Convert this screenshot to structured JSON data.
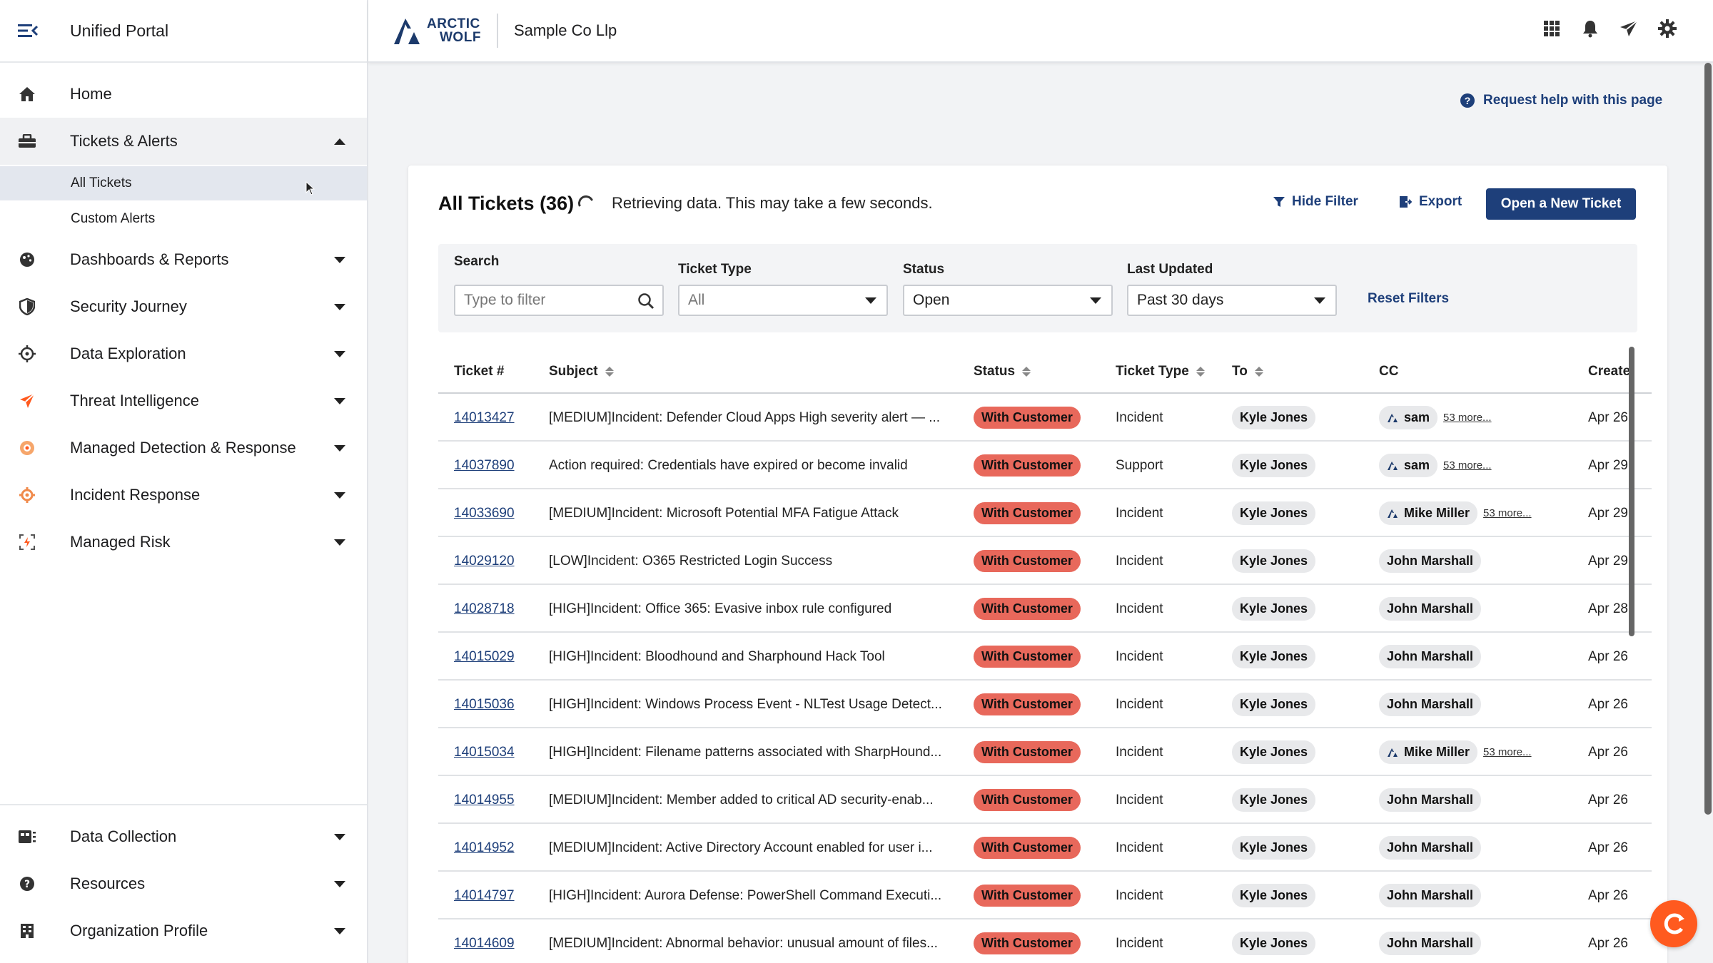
{
  "sidebar": {
    "app_title": "Unified Portal",
    "items": [
      {
        "label": "Home",
        "icon": "home-icon"
      },
      {
        "label": "Tickets & Alerts",
        "icon": "ticket-icon"
      },
      {
        "label": "Dashboards & Reports",
        "icon": "dashboard-icon"
      },
      {
        "label": "Security Journey",
        "icon": "shield-icon"
      },
      {
        "label": "Data Exploration",
        "icon": "crosshair-icon"
      },
      {
        "label": "Threat Intelligence",
        "icon": "send-icon"
      },
      {
        "label": "Managed Detection & Response",
        "icon": "mdr-icon"
      },
      {
        "label": "Incident Response",
        "icon": "incident-icon"
      },
      {
        "label": "Managed Risk",
        "icon": "risk-icon"
      },
      {
        "label": "Data Collection",
        "icon": "data-collection-icon"
      },
      {
        "label": "Resources",
        "icon": "help-icon"
      },
      {
        "label": "Organization Profile",
        "icon": "building-icon"
      }
    ],
    "sub_items": [
      {
        "label": "All Tickets"
      },
      {
        "label": "Custom Alerts"
      }
    ]
  },
  "topbar": {
    "logo_line1": "ARCTIC",
    "logo_line2": "WOLF",
    "org_name": "Sample Co Llp"
  },
  "help_link": "Request help with this page",
  "tickets": {
    "title": "All Tickets (36)",
    "loading_text": "Retrieving data. This may take a few seconds.",
    "hide_filter": "Hide Filter",
    "export": "Export",
    "open_ticket": "Open a New Ticket",
    "filters": {
      "search_label": "Search",
      "search_placeholder": "Type to filter",
      "type_label": "Ticket Type",
      "type_value": "All",
      "status_label": "Status",
      "status_value": "Open",
      "updated_label": "Last Updated",
      "updated_value": "Past 30 days",
      "reset": "Reset Filters"
    },
    "columns": {
      "ticket": "Ticket #",
      "subject": "Subject",
      "status": "Status",
      "type": "Ticket Type",
      "to": "To",
      "cc": "CC",
      "created": "Create"
    },
    "rows": [
      {
        "num": "14013427",
        "subject": "[MEDIUM]Incident: Defender Cloud Apps High severity alert — ...",
        "status": "With Customer",
        "type": "Incident",
        "to": "Kyle Jones",
        "cc": "sam",
        "cc_logo": true,
        "more": "53 more...",
        "created": "Apr 26"
      },
      {
        "num": "14037890",
        "subject": "Action required: Credentials have expired or become invalid",
        "status": "With Customer",
        "type": "Support",
        "to": "Kyle Jones",
        "cc": "sam",
        "cc_logo": true,
        "more": "53 more...",
        "created": "Apr 29"
      },
      {
        "num": "14033690",
        "subject": "[MEDIUM]Incident: Microsoft Potential MFA Fatigue Attack",
        "status": "With Customer",
        "type": "Incident",
        "to": "Kyle Jones",
        "cc": "Mike Miller",
        "cc_logo": true,
        "more": "53 more...",
        "created": "Apr 29"
      },
      {
        "num": "14029120",
        "subject": "[LOW]Incident: O365 Restricted Login Success",
        "status": "With Customer",
        "type": "Incident",
        "to": "Kyle Jones",
        "cc": "John Marshall",
        "cc_logo": false,
        "more": "",
        "created": "Apr 29"
      },
      {
        "num": "14028718",
        "subject": "[HIGH]Incident: Office 365: Evasive inbox rule configured",
        "status": "With Customer",
        "type": "Incident",
        "to": "Kyle Jones",
        "cc": "John Marshall",
        "cc_logo": false,
        "more": "",
        "created": "Apr 28"
      },
      {
        "num": "14015029",
        "subject": "[HIGH]Incident: Bloodhound and Sharphound Hack Tool",
        "status": "With Customer",
        "type": "Incident",
        "to": "Kyle Jones",
        "cc": "John Marshall",
        "cc_logo": false,
        "more": "",
        "created": "Apr 26"
      },
      {
        "num": "14015036",
        "subject": "[HIGH]Incident: Windows Process Event - NLTest Usage Detect...",
        "status": "With Customer",
        "type": "Incident",
        "to": "Kyle Jones",
        "cc": "John Marshall",
        "cc_logo": false,
        "more": "",
        "created": "Apr 26"
      },
      {
        "num": "14015034",
        "subject": "[HIGH]Incident: Filename patterns associated with SharpHound...",
        "status": "With Customer",
        "type": "Incident",
        "to": "Kyle Jones",
        "cc": "Mike Miller",
        "cc_logo": true,
        "more": "53 more...",
        "created": "Apr 26"
      },
      {
        "num": "14014955",
        "subject": "[MEDIUM]Incident: Member added to critical AD security-enab...",
        "status": "With Customer",
        "type": "Incident",
        "to": "Kyle Jones",
        "cc": "John Marshall",
        "cc_logo": false,
        "more": "",
        "created": "Apr 26"
      },
      {
        "num": "14014952",
        "subject": "[MEDIUM]Incident: Active Directory Account enabled for user i...",
        "status": "With Customer",
        "type": "Incident",
        "to": "Kyle Jones",
        "cc": "John Marshall",
        "cc_logo": false,
        "more": "",
        "created": "Apr 26"
      },
      {
        "num": "14014797",
        "subject": "[HIGH]Incident: Aurora Defense: PowerShell Command Executi...",
        "status": "With Customer",
        "type": "Incident",
        "to": "Kyle Jones",
        "cc": "John Marshall",
        "cc_logo": false,
        "more": "",
        "created": "Apr 26"
      },
      {
        "num": "14014609",
        "subject": "[MEDIUM]Incident: Abnormal behavior: unusual amount of files...",
        "status": "With Customer",
        "type": "Incident",
        "to": "Kyle Jones",
        "cc": "John Marshall",
        "cc_logo": false,
        "more": "",
        "created": "Apr 26"
      }
    ]
  },
  "colors": {
    "brand": "#1e3f7a",
    "status_badge": "#e8685b",
    "chat_button": "#ff5a1f"
  }
}
